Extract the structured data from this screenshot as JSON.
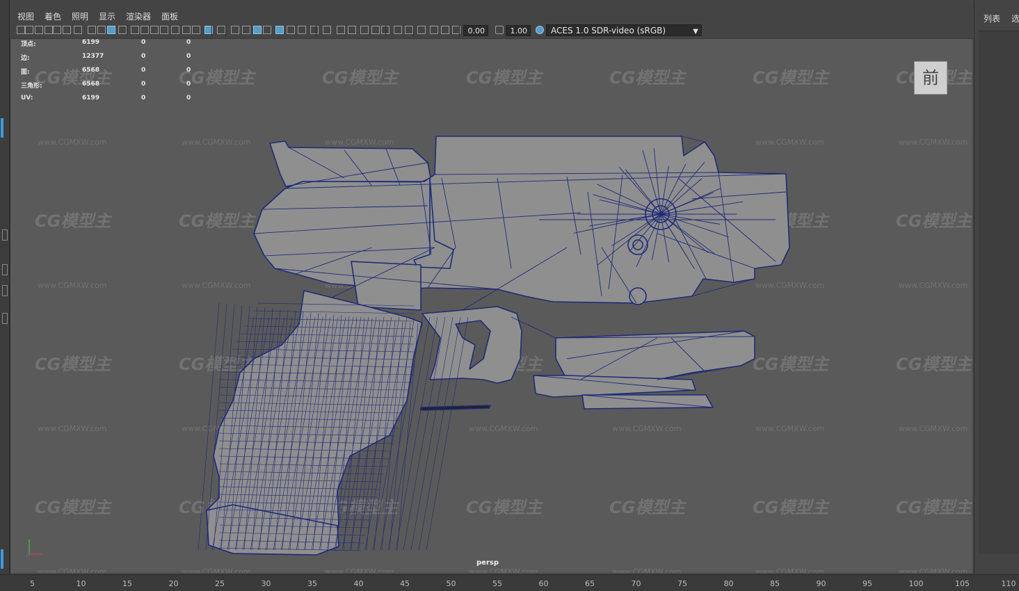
{
  "menu": [
    "视图",
    "着色",
    "照明",
    "显示",
    "渲染器",
    "面板"
  ],
  "toolbar": {
    "exposure_value": "0.00",
    "gamma_value": "1.00",
    "color_space": "ACES 1.0 SDR-video (sRGB)"
  },
  "hud_stats": [
    {
      "label": "顶点:",
      "v1": "6199",
      "v2": "0",
      "v3": "0"
    },
    {
      "label": "边:",
      "v1": "12377",
      "v2": "0",
      "v3": "0"
    },
    {
      "label": "面:",
      "v1": "6568",
      "v2": "0",
      "v3": "0"
    },
    {
      "label": "三角形:",
      "v1": "6568",
      "v2": "0",
      "v3": "0"
    },
    {
      "label": "UV:",
      "v1": "6199",
      "v2": "0",
      "v3": "0"
    }
  ],
  "viewcube_label": "前",
  "camera_label": "persp",
  "watermark": {
    "brand": "CG模型主",
    "url": "www.CGMXW.com"
  },
  "right_panel": {
    "tab1": "列表",
    "tab2": "选"
  },
  "timeline_ticks": [
    "5",
    "10",
    "15",
    "20",
    "25",
    "30",
    "35",
    "40",
    "45",
    "50",
    "55",
    "60",
    "65",
    "70",
    "75",
    "80",
    "85",
    "90",
    "95",
    "100",
    "105",
    "110"
  ],
  "colors": {
    "wire": "#1f2a78",
    "mesh_fill": "#8f8f8f",
    "viewport_bg": "#5a5a5a",
    "accent": "#5a9bc5"
  }
}
